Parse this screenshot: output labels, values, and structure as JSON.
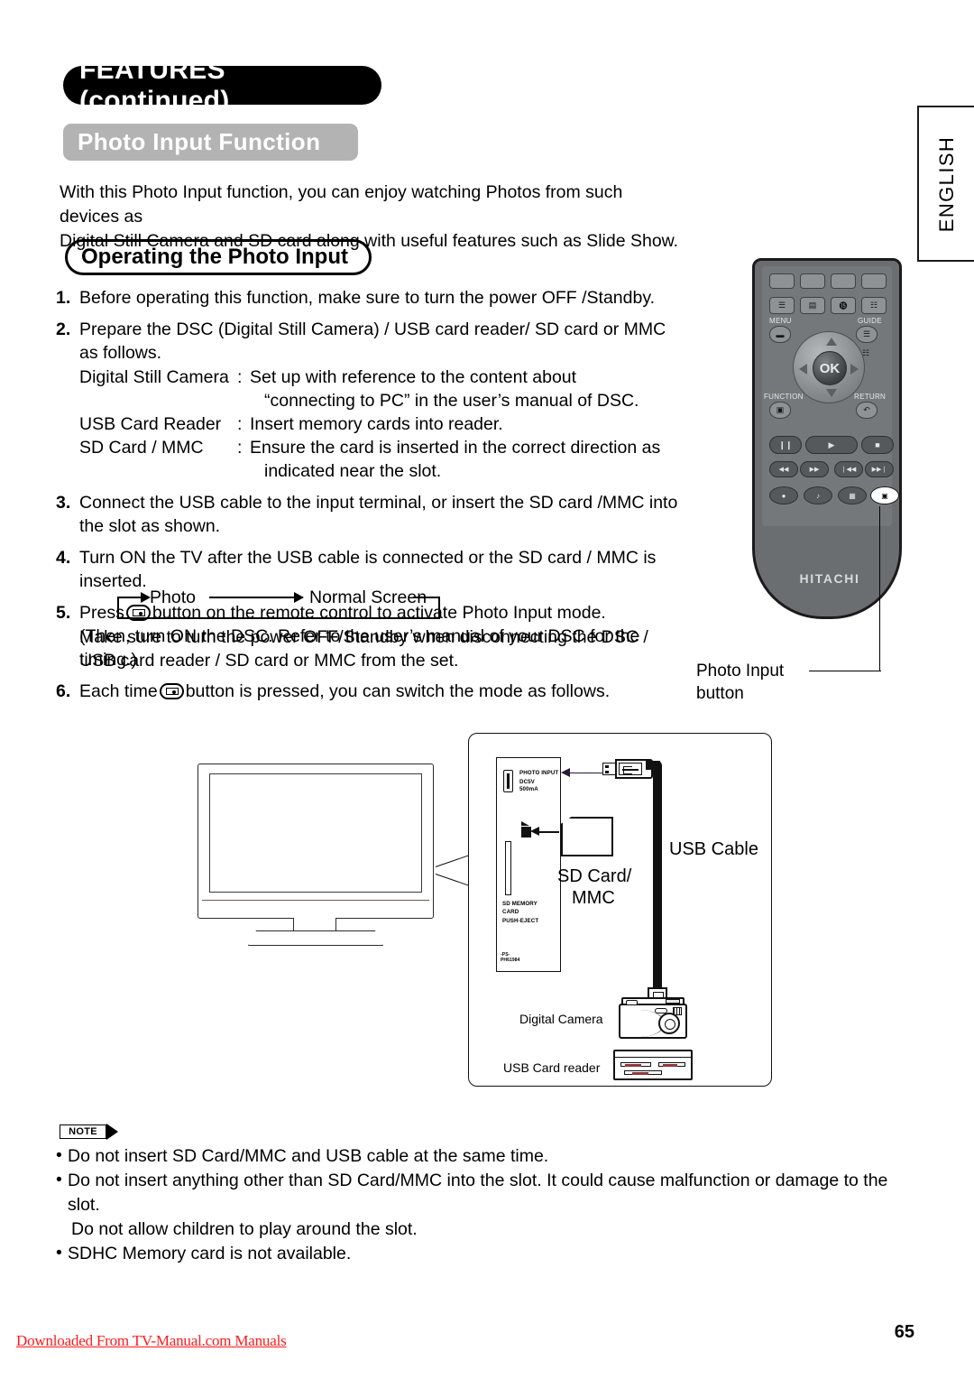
{
  "header": {
    "chapter_title": "FEATURES (continued)",
    "section_title": "Photo Input Function",
    "subsection_title": "Operating the Photo Input",
    "language_tab": "ENGLISH"
  },
  "intro": {
    "line1": "With this Photo Input function, you can enjoy watching Photos from such devices as",
    "line2": "Digital Still Camera and SD card along with useful features such as Slide Show."
  },
  "steps": [
    {
      "num": "1.",
      "text": "Before operating this function, make sure to turn the power OFF /Standby."
    },
    {
      "num": "2.",
      "text": "Prepare the DSC (Digital Still Camera) / USB card reader/ SD card or MMC as follows.",
      "rows": [
        {
          "key": "Digital Still Camera",
          "colon": ":",
          "value": "Set up with reference to the content about",
          "value2": "“connecting to PC” in the user’s manual of DSC."
        },
        {
          "key": "USB Card Reader",
          "colon": ":",
          "value": "Insert memory cards into reader.",
          "value2": ""
        },
        {
          "key": "SD Card / MMC",
          "colon": ":",
          "value": "Ensure the card is inserted in the correct direction as",
          "value2": "indicated near the slot."
        }
      ]
    },
    {
      "num": "3.",
      "text": "Connect the USB cable to the input terminal, or insert the SD card /MMC into the slot as shown."
    },
    {
      "num": "4.",
      "text": "Turn ON the TV after the USB cable is connected or the SD card / MMC is inserted."
    },
    {
      "num": "5.",
      "pre": "Press",
      "post": "button on the remote control to activate Photo Input mode.",
      "line2": "(Then, turn ON the DSC. Refer to the user’s manual of your DSC for the timing.)"
    },
    {
      "num": "6.",
      "pre": "Each time",
      "post": "button is pressed, you can switch the mode as follows."
    }
  ],
  "cycle": {
    "mode_a": "Photo",
    "mode_b": "Normal Screen"
  },
  "tail_note": "Make sure to turn the power OFF/Standby when disconnecting the DSC / USB card reader / SD card or MMC from the set.",
  "remote": {
    "brand": "HITACHI",
    "ok_label": "OK",
    "labels": {
      "menu": "MENU",
      "guide": "GUIDE",
      "function": "FUNCTION",
      "return": "RETURN"
    },
    "top_row_icons": [
      "blank-button",
      "blank-button",
      "blank-button",
      "blank-button"
    ],
    "teletext_icons": [
      "teletext-index-icon",
      "teletext-reveal-icon",
      "teletext-subtitle-icon",
      "teletext-list-icon"
    ],
    "transport_icons": [
      "pause-icon",
      "play-icon",
      "stop-icon"
    ],
    "skip_icons": [
      "rewind-icon",
      "fast-forward-icon",
      "previous-track-icon",
      "next-track-icon"
    ],
    "bottom_icons": [
      "record-icon",
      "audio-icon",
      "screen-format-icon",
      "photo-input-icon"
    ],
    "glyphs": {
      "pause": "❙❙",
      "play": "▶",
      "stop": "■",
      "rewind": "◀◀",
      "forward": "▶▶",
      "prev": "❘◀◀",
      "next": "▶▶❘",
      "record": "●",
      "audio": "♪"
    },
    "callout": {
      "line1": "Photo Input",
      "line2": "button"
    }
  },
  "diagram": {
    "port_labels": {
      "photo_input": "PHOTO  INPUT",
      "dc": "DC5V",
      "current": "500mA",
      "sd_memory": "SD  MEMORY",
      "card": "CARD",
      "push_eject": "PUSH-EJECT",
      "part_mark": "-PS-",
      "part_number": "PH61984"
    },
    "labels": {
      "usb_cable": "USB Cable",
      "sd_card_1": "SD Card/",
      "sd_card_2": "MMC",
      "digital_camera": "Digital Camera",
      "usb_card_reader": "USB Card reader"
    }
  },
  "note": {
    "tag": "NOTE",
    "items": [
      {
        "text": "Do not insert SD Card/MMC and USB cable at the same time.",
        "cont": ""
      },
      {
        "text": "Do not insert anything other than SD Card/MMC into the slot. It could cause malfunction or damage to the slot.",
        "cont": "Do not allow children to play around the slot."
      },
      {
        "text": "SDHC Memory card is not available.",
        "cont": ""
      }
    ],
    "bullet": "•"
  },
  "footer": {
    "page_number": "65",
    "download_text": "Downloaded From TV-Manual.com Manuals"
  },
  "colors": {
    "chapter_pill_bg": "#000000",
    "section_pill_bg": "#b3b3b3",
    "remote_body": "#6b6e70",
    "link_red": "#ff1a1a"
  }
}
